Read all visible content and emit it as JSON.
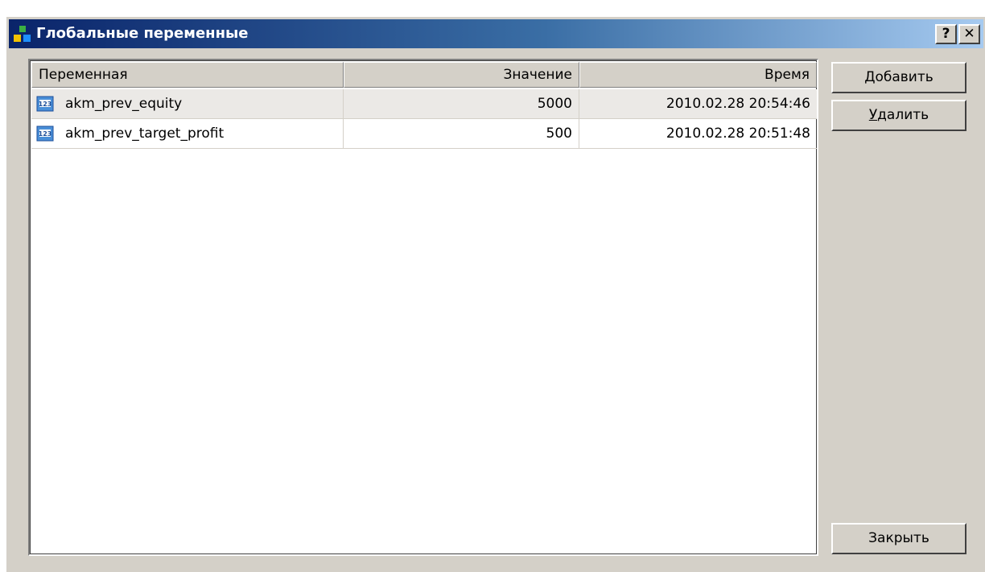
{
  "window": {
    "title": "Глобальные переменные",
    "help_label": "?",
    "close_label": "✕"
  },
  "columns": {
    "variable": "Переменная",
    "value": "Значение",
    "time": "Время"
  },
  "rows": [
    {
      "name": "akm_prev_equity",
      "value": "5000",
      "time": "2010.02.28 20:54:46",
      "icon": "numeric-variable-icon",
      "selected": true
    },
    {
      "name": "akm_prev_target_profit",
      "value": "500",
      "time": "2010.02.28 20:51:48",
      "icon": "numeric-variable-icon",
      "selected": false
    }
  ],
  "buttons": {
    "add": {
      "mnemonic": "Д",
      "rest": "обавить"
    },
    "delete": {
      "mnemonic": "У",
      "rest": "далить"
    },
    "close": "Закрыть"
  },
  "colors": {
    "titlebar_start": "#0a246a",
    "titlebar_end": "#a6caf0",
    "dialog_face": "#d4d0c8",
    "selected_row": "#ebe9e6"
  }
}
